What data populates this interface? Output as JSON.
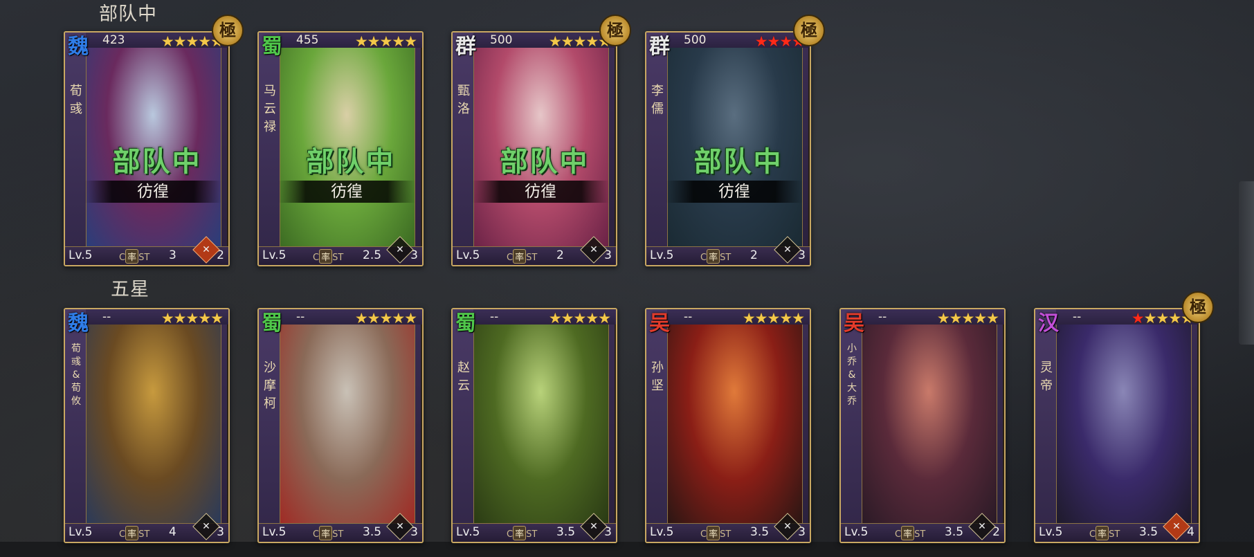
{
  "sections": {
    "deployed_title": "部队中",
    "five_star_title": "五星"
  },
  "colors": {
    "wei": "#2f7de8",
    "shu": "#4fc64a",
    "qun": "#e8e8e8",
    "wu": "#e23b2b",
    "han": "#c24fd8"
  },
  "deployed_cards": [
    {
      "faction": "魏",
      "cost": "423",
      "name": "荀彧",
      "stars": "★★★★★",
      "red_stars": "",
      "lv": "Lv.5",
      "c_label": "C",
      "stat": "率",
      "st": "ST",
      "c_value": "3",
      "troop_value": "2",
      "status": "部队中",
      "state": "彷徨",
      "portrait_colors": [
        "#b9c8de",
        "#6a2a5e",
        "#2a3e7a"
      ]
    },
    {
      "faction": "蜀",
      "cost": "455",
      "name": "马云禄",
      "stars": "★★★★★",
      "red_stars": "",
      "lv": "Lv.5",
      "c_label": "C",
      "stat": "率",
      "st": "ST",
      "c_value": "2.5",
      "troop_value": "3",
      "status": "部队中",
      "state": "彷徨",
      "portrait_colors": [
        "#d9cfa6",
        "#6aa73b",
        "#3b6a22"
      ]
    },
    {
      "faction": "群",
      "cost": "500",
      "name": "甄洛",
      "stars": "★★★★★",
      "red_stars": "",
      "lv": "Lv.5",
      "c_label": "C",
      "stat": "率",
      "st": "ST",
      "c_value": "2",
      "troop_value": "3",
      "status": "部队中",
      "state": "彷徨",
      "portrait_colors": [
        "#e6c6c8",
        "#b24a6a",
        "#6a2246"
      ]
    },
    {
      "faction": "群",
      "cost": "500",
      "name": "李儒",
      "stars": "",
      "red_stars": "★★★★",
      "lv": "Lv.5",
      "c_label": "C",
      "stat": "率",
      "st": "ST",
      "c_value": "2",
      "troop_value": "3",
      "status": "部队中",
      "state": "彷徨",
      "portrait_colors": [
        "#5a6e80",
        "#283a4a",
        "#1a2a33"
      ]
    }
  ],
  "five_star_cards": [
    {
      "faction": "魏",
      "cost": "--",
      "name": "荀彧&荀攸",
      "stars": "★★★★★",
      "red_stars": "",
      "lv": "Lv.5",
      "c_label": "C",
      "stat": "率",
      "st": "ST",
      "c_value": "4",
      "troop_value": "3",
      "portrait_colors": [
        "#c79a3e",
        "#6a4a22",
        "#2a3a5a"
      ]
    },
    {
      "faction": "蜀",
      "cost": "--",
      "name": "沙摩柯",
      "stars": "★★★★★",
      "red_stars": "",
      "lv": "Lv.5",
      "c_label": "C",
      "stat": "率",
      "st": "ST",
      "c_value": "3.5",
      "troop_value": "3",
      "portrait_colors": [
        "#c9c1b6",
        "#8a6a58",
        "#a02a24"
      ]
    },
    {
      "faction": "蜀",
      "cost": "--",
      "name": "赵云",
      "stars": "★★★★★",
      "red_stars": "",
      "lv": "Lv.5",
      "c_label": "C",
      "stat": "率",
      "st": "ST",
      "c_value": "3.5",
      "troop_value": "3",
      "portrait_colors": [
        "#b8d27a",
        "#4e6a22",
        "#2a3a14"
      ]
    },
    {
      "faction": "吴",
      "cost": "--",
      "name": "孙坚",
      "stars": "★★★★★",
      "red_stars": "",
      "lv": "Lv.5",
      "c_label": "C",
      "stat": "率",
      "st": "ST",
      "c_value": "3.5",
      "troop_value": "3",
      "portrait_colors": [
        "#e07a3a",
        "#8a1e16",
        "#2a1614"
      ]
    },
    {
      "faction": "吴",
      "cost": "--",
      "name": "小乔&大乔",
      "stars": "★★★★★",
      "red_stars": "",
      "lv": "Lv.5",
      "c_label": "C",
      "stat": "率",
      "st": "ST",
      "c_value": "3.5",
      "troop_value": "2",
      "portrait_colors": [
        "#c97a6a",
        "#5a2a3a",
        "#2a1a26"
      ]
    },
    {
      "faction": "汉",
      "cost": "--",
      "name": "灵帝",
      "stars": "★★★★",
      "red_stars": "★",
      "lv": "Lv.5",
      "c_label": "C",
      "stat": "率",
      "st": "ST",
      "c_value": "3.5",
      "troop_value": "4",
      "portrait_colors": [
        "#8a86b6",
        "#3a2a6a",
        "#1e1a2a"
      ]
    }
  ],
  "kyoku_label": "極"
}
